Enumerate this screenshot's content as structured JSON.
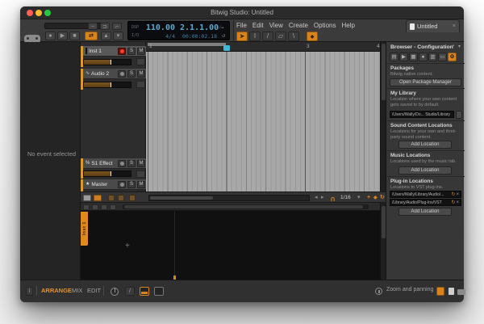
{
  "window": {
    "title": "Bitwig Studio: Untitled"
  },
  "menu": {
    "items": [
      "File",
      "Edit",
      "View",
      "Create",
      "Options",
      "Help"
    ]
  },
  "transport": {
    "dsp_label": "DSP",
    "io_label": "I/O",
    "tempo": "110.00",
    "time_signature": "4/4",
    "position": "2.1.1.00",
    "time": "00:00:02.18"
  },
  "document_tab": {
    "label": "Untitled",
    "close": "×"
  },
  "inspector": {
    "message": "No event selected"
  },
  "track_list": {
    "tracks": [
      {
        "name": "Inst 1",
        "type": "instrument",
        "armed": true,
        "solo": "S",
        "mute": "M"
      },
      {
        "name": "Audio 2",
        "type": "audio",
        "armed": false,
        "solo": "S",
        "mute": "M"
      },
      {
        "name": "S1 Effect",
        "type": "effect",
        "armed": false,
        "solo": "S",
        "mute": "M"
      },
      {
        "name": "Master",
        "type": "master",
        "armed": false,
        "solo": "S",
        "mute": "M"
      }
    ]
  },
  "ruler": {
    "labels": [
      "1",
      "3",
      "4"
    ]
  },
  "arranger_footer": {
    "grid_value": "1/16"
  },
  "detail_editor": {
    "tab_label": "Inst 1"
  },
  "browser": {
    "title": "Browser - Configuration",
    "sections": {
      "packages": {
        "title": "Packages",
        "description": "Bitwig native content.",
        "button": "Open Package Manager"
      },
      "my_library": {
        "title": "My Library",
        "description": "Location where your own content gets saved to by default.",
        "path": "/Users/Wally/Do... Studio/Library"
      },
      "sound_content": {
        "title": "Sound Content Locations",
        "description": "Locations for your own and third-party sound content.",
        "button": "Add Location"
      },
      "music": {
        "title": "Music Locations",
        "description": "Locations used by the music tab.",
        "button": "Add Location"
      },
      "plugins": {
        "title": "Plug-in Locations",
        "description": "Locations to VST plug-ins.",
        "path_1": "/Users/Wally/Library/Audio/...",
        "path_2": "/Library/Audio/Plug-Ins/VST",
        "button": "Add Location"
      }
    }
  },
  "bottom_bar": {
    "views": [
      "ARRANGE",
      "MIX",
      "EDIT"
    ],
    "zoom_label": "Zoom and panning"
  },
  "icons": {
    "record": "●",
    "play": "▶",
    "stop": "■",
    "loop": "⇄",
    "metronome": "▲",
    "caret": "▾",
    "curve_a": "~",
    "curve_b": "⊃",
    "curve_c": "⌐",
    "edit_pencil": "⁄",
    "edit_arrow": "→",
    "undo_loop": "↺",
    "pointer": "➤",
    "ibeam": "I",
    "pen": "/",
    "eraser": "▱",
    "knife": "\\",
    "snap_dot": "◆",
    "left": "◂",
    "right": "▸",
    "magnet": "U",
    "plus": "+",
    "diamond": "◆",
    "refresh": "↻",
    "close": "×",
    "tab_files": "▤",
    "tab_play": "▶",
    "tab_save": "▦",
    "tab_info": "●",
    "tab_chart": "▥",
    "tab_monitor": "▭",
    "tab_gear": "⚙",
    "wave": "∿",
    "percent": "%",
    "star": "★",
    "pin": "▪",
    "menu_sq": "▾",
    "crosshair": "+",
    "info": "i"
  },
  "colors": {
    "accent": "#d8831c",
    "display_text": "#5fa8cc",
    "armed_red": "#ff3b28",
    "track_color": "#d99a2e",
    "playhead": "#3fb7d6"
  }
}
